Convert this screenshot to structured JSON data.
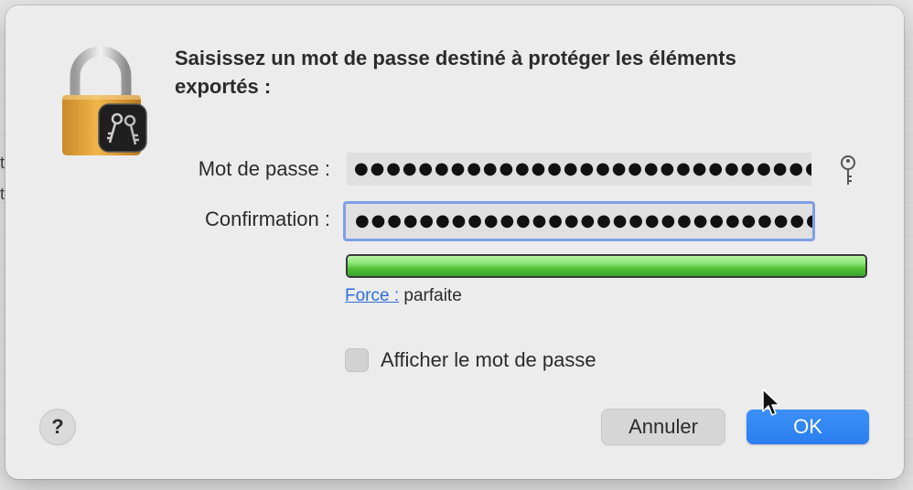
{
  "background": {
    "fragments": [
      "t",
      "t"
    ]
  },
  "dialog": {
    "title": "Saisissez un mot de passe destiné à protéger les éléments exportés :",
    "password_label": "Mot de passe :",
    "password_value": "●●●●●●●●●●●●●●●●●●●●●●●●●●●●●●",
    "confirmation_label": "Confirmation :",
    "confirmation_value": "●●●●●●●●●●●●●●●●●●●●●●●●●●●●●●",
    "strength_link": "Force :",
    "strength_value": "parfaite",
    "strength_level": 1.0,
    "show_password_label": "Afficher le mot de passe",
    "show_password_checked": false,
    "help_label": "?",
    "cancel_label": "Annuler",
    "ok_label": "OK"
  },
  "colors": {
    "accent": "#2b7ef0",
    "focus_ring": "#7f9fe6",
    "meter_green": "#55c43c",
    "link": "#2f6ed8"
  },
  "icons": [
    "lock-keychain-icon",
    "key-icon",
    "mouse-cursor-icon"
  ]
}
